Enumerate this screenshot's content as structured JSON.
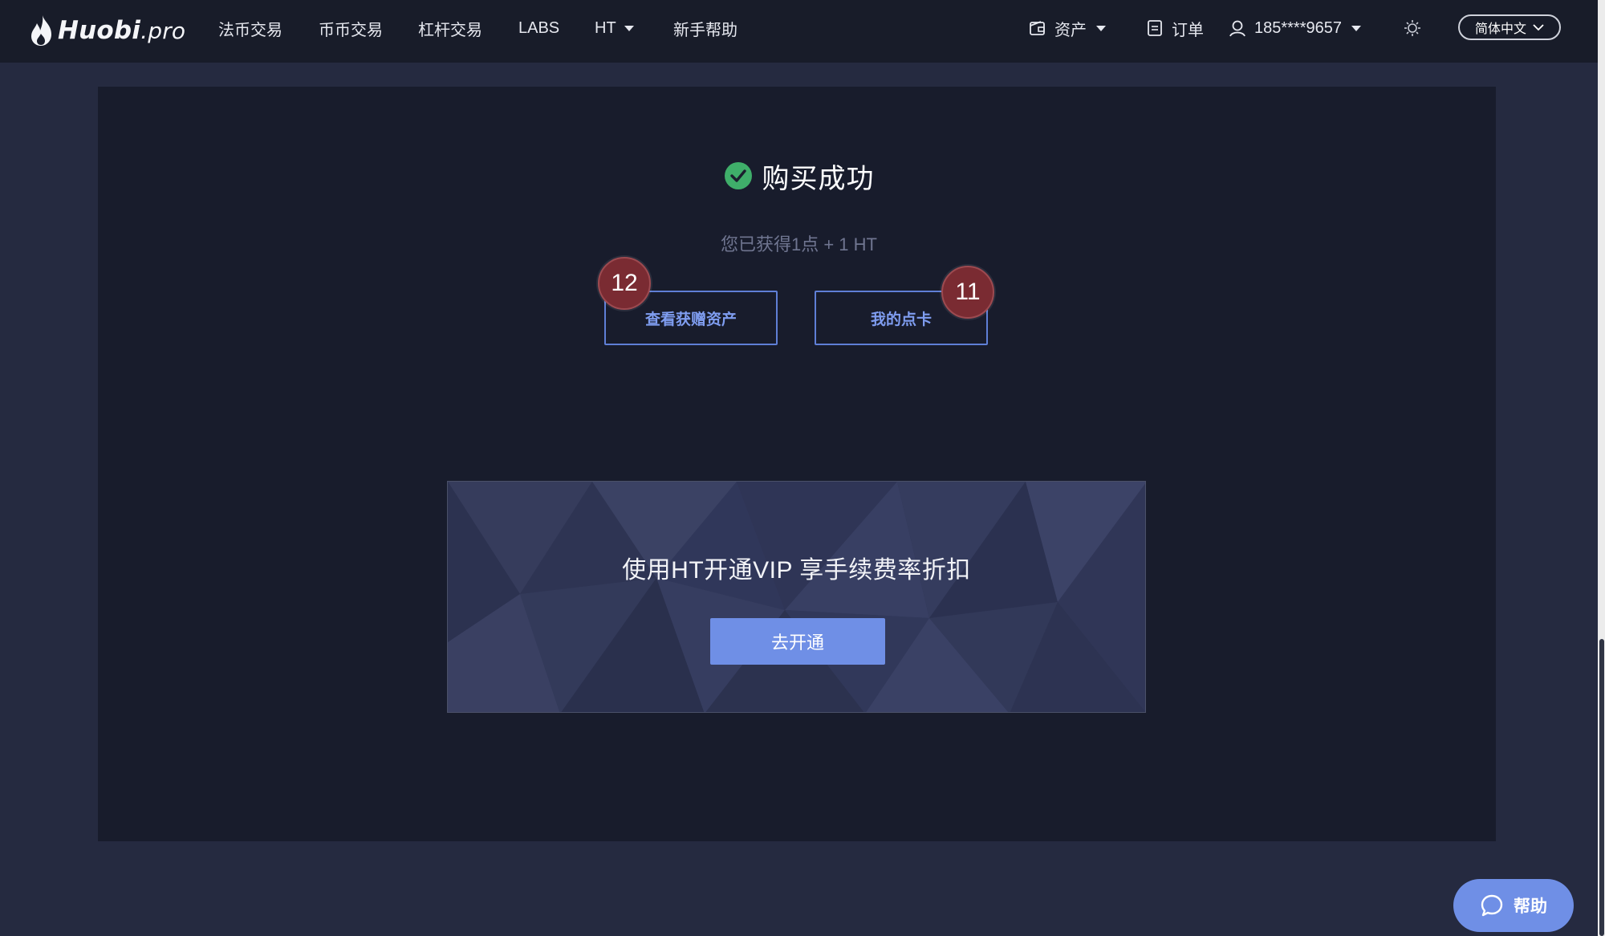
{
  "header": {
    "logo": {
      "brand": "Huobi",
      "suffix": ".pro"
    },
    "nav": [
      {
        "label": "法币交易"
      },
      {
        "label": "币币交易"
      },
      {
        "label": "杠杆交易"
      },
      {
        "label": "LABS"
      },
      {
        "label": "HT",
        "has_dropdown": true
      },
      {
        "label": "新手帮助"
      }
    ],
    "assets": {
      "label": "资产",
      "icon": "wallet-icon"
    },
    "orders": {
      "label": "订单",
      "icon": "document-icon"
    },
    "user": {
      "label": "185****9657",
      "icon": "user-icon"
    },
    "theme_icon": "sun-icon",
    "language": {
      "label": "简体中文",
      "icon": "chevron-down-icon"
    }
  },
  "main": {
    "title": "购买成功",
    "title_icon": "check-circle-icon",
    "subtext": "您已获得1点 + 1 HT",
    "buttons": [
      {
        "label": "查看获赠资产"
      },
      {
        "label": "我的点卡"
      }
    ],
    "markers": [
      "12",
      "11"
    ]
  },
  "banner": {
    "title": "使用HT开通VIP 享手续费率折扣",
    "button_label": "去开通"
  },
  "help": {
    "label": "帮助",
    "icon": "chat-bubble-icon"
  },
  "colors": {
    "page_bg": "#252a40",
    "header_bg": "#181c29",
    "panel_bg": "#181c2c",
    "accent": "#6f8fe6",
    "success": "#3fae6a",
    "marker": "#7a2b32"
  }
}
